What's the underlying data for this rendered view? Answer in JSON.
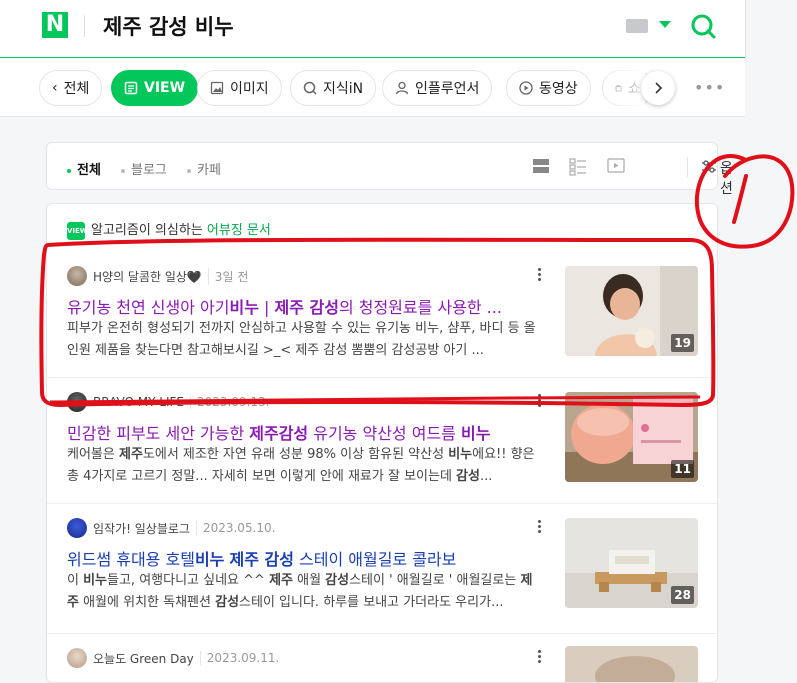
{
  "header": {
    "logo": "N",
    "query": "제주 감성 비누"
  },
  "tabs": [
    {
      "label": "전체",
      "icon": "chevron-left-icon"
    },
    {
      "label": "VIEW",
      "icon": "document-icon",
      "active": true
    },
    {
      "label": "이미지",
      "icon": "image-icon"
    },
    {
      "label": "지식iN",
      "icon": "q-icon"
    },
    {
      "label": "인플루언서",
      "icon": "person-icon"
    },
    {
      "label": "동영상",
      "icon": "play-icon"
    },
    {
      "label": "쇼",
      "icon": "bag-icon"
    }
  ],
  "filters": {
    "items": [
      "전체",
      "블로그",
      "카페"
    ],
    "active": "전체",
    "option_label": "옵션"
  },
  "notice": {
    "prefix": "알고리즘이 의심하는",
    "link": "어뷰징 문서",
    "badge": "VIEW"
  },
  "results": [
    {
      "author": "H양의 달콤한 일상🖤",
      "date": "3일 전",
      "title_parts": [
        "유기농 천연 신생아 아기",
        "비누",
        " | ",
        "제주 감성",
        "의 청정원료를 사용한 ..."
      ],
      "desc": "피부가 온전히 형성되기 전까지 안심하고 사용할 수 있는 유기농 비누, 샴푸, 바디 등 올인원 제품을 찾는다면 참고해보시길 >_< 제주 감성 뽐뿜의 감성공방 아기 ...",
      "count": "19",
      "title_color": "#8b1ab3"
    },
    {
      "author": "BRAVO MY LIFE",
      "date": "2023.09.13.",
      "title_parts": [
        "민감한 피부도 세안 가능한 ",
        "제주감성",
        " 유기농 약산성 여드름 ",
        "비누",
        ""
      ],
      "desc_parts": [
        "케어볼은 ",
        "제주",
        "도에서 제조한 자연 유래 성분 98% 이상 함유된 약산성 ",
        "비누",
        "에요!! 향은 총 4가지로 고르기 정말... 자세히 보면 이렇게 안에 재료가 잘 보이는데 ",
        "감성",
        "..."
      ],
      "count": "11",
      "title_color": "#8b1ab3"
    },
    {
      "author": "임작가! 일상블로그",
      "date": "2023.05.10.",
      "title_parts": [
        "위드썸 휴대용 호텔",
        "비누",
        " ",
        "제주 감성",
        " 스테이 애월길로 콜라보"
      ],
      "desc_parts": [
        "이 ",
        "비누",
        "들고, 여행다니고 싶네요 ^^ ",
        "제주",
        " 애월 ",
        "감성",
        "스테이 ' 애월길로 ' 애월길로는 ",
        "제주",
        " 애월에 위치한 독채펜션 ",
        "감성",
        "스테이 입니다. 하루를 보내고 가더라도 우리가..."
      ],
      "count": "28",
      "title_color": "#1a3fb0"
    },
    {
      "author": "오늘도 Green Day",
      "date": "2023.09.11."
    }
  ],
  "annotation": {
    "mark": "1",
    "color": "#e0101a"
  }
}
